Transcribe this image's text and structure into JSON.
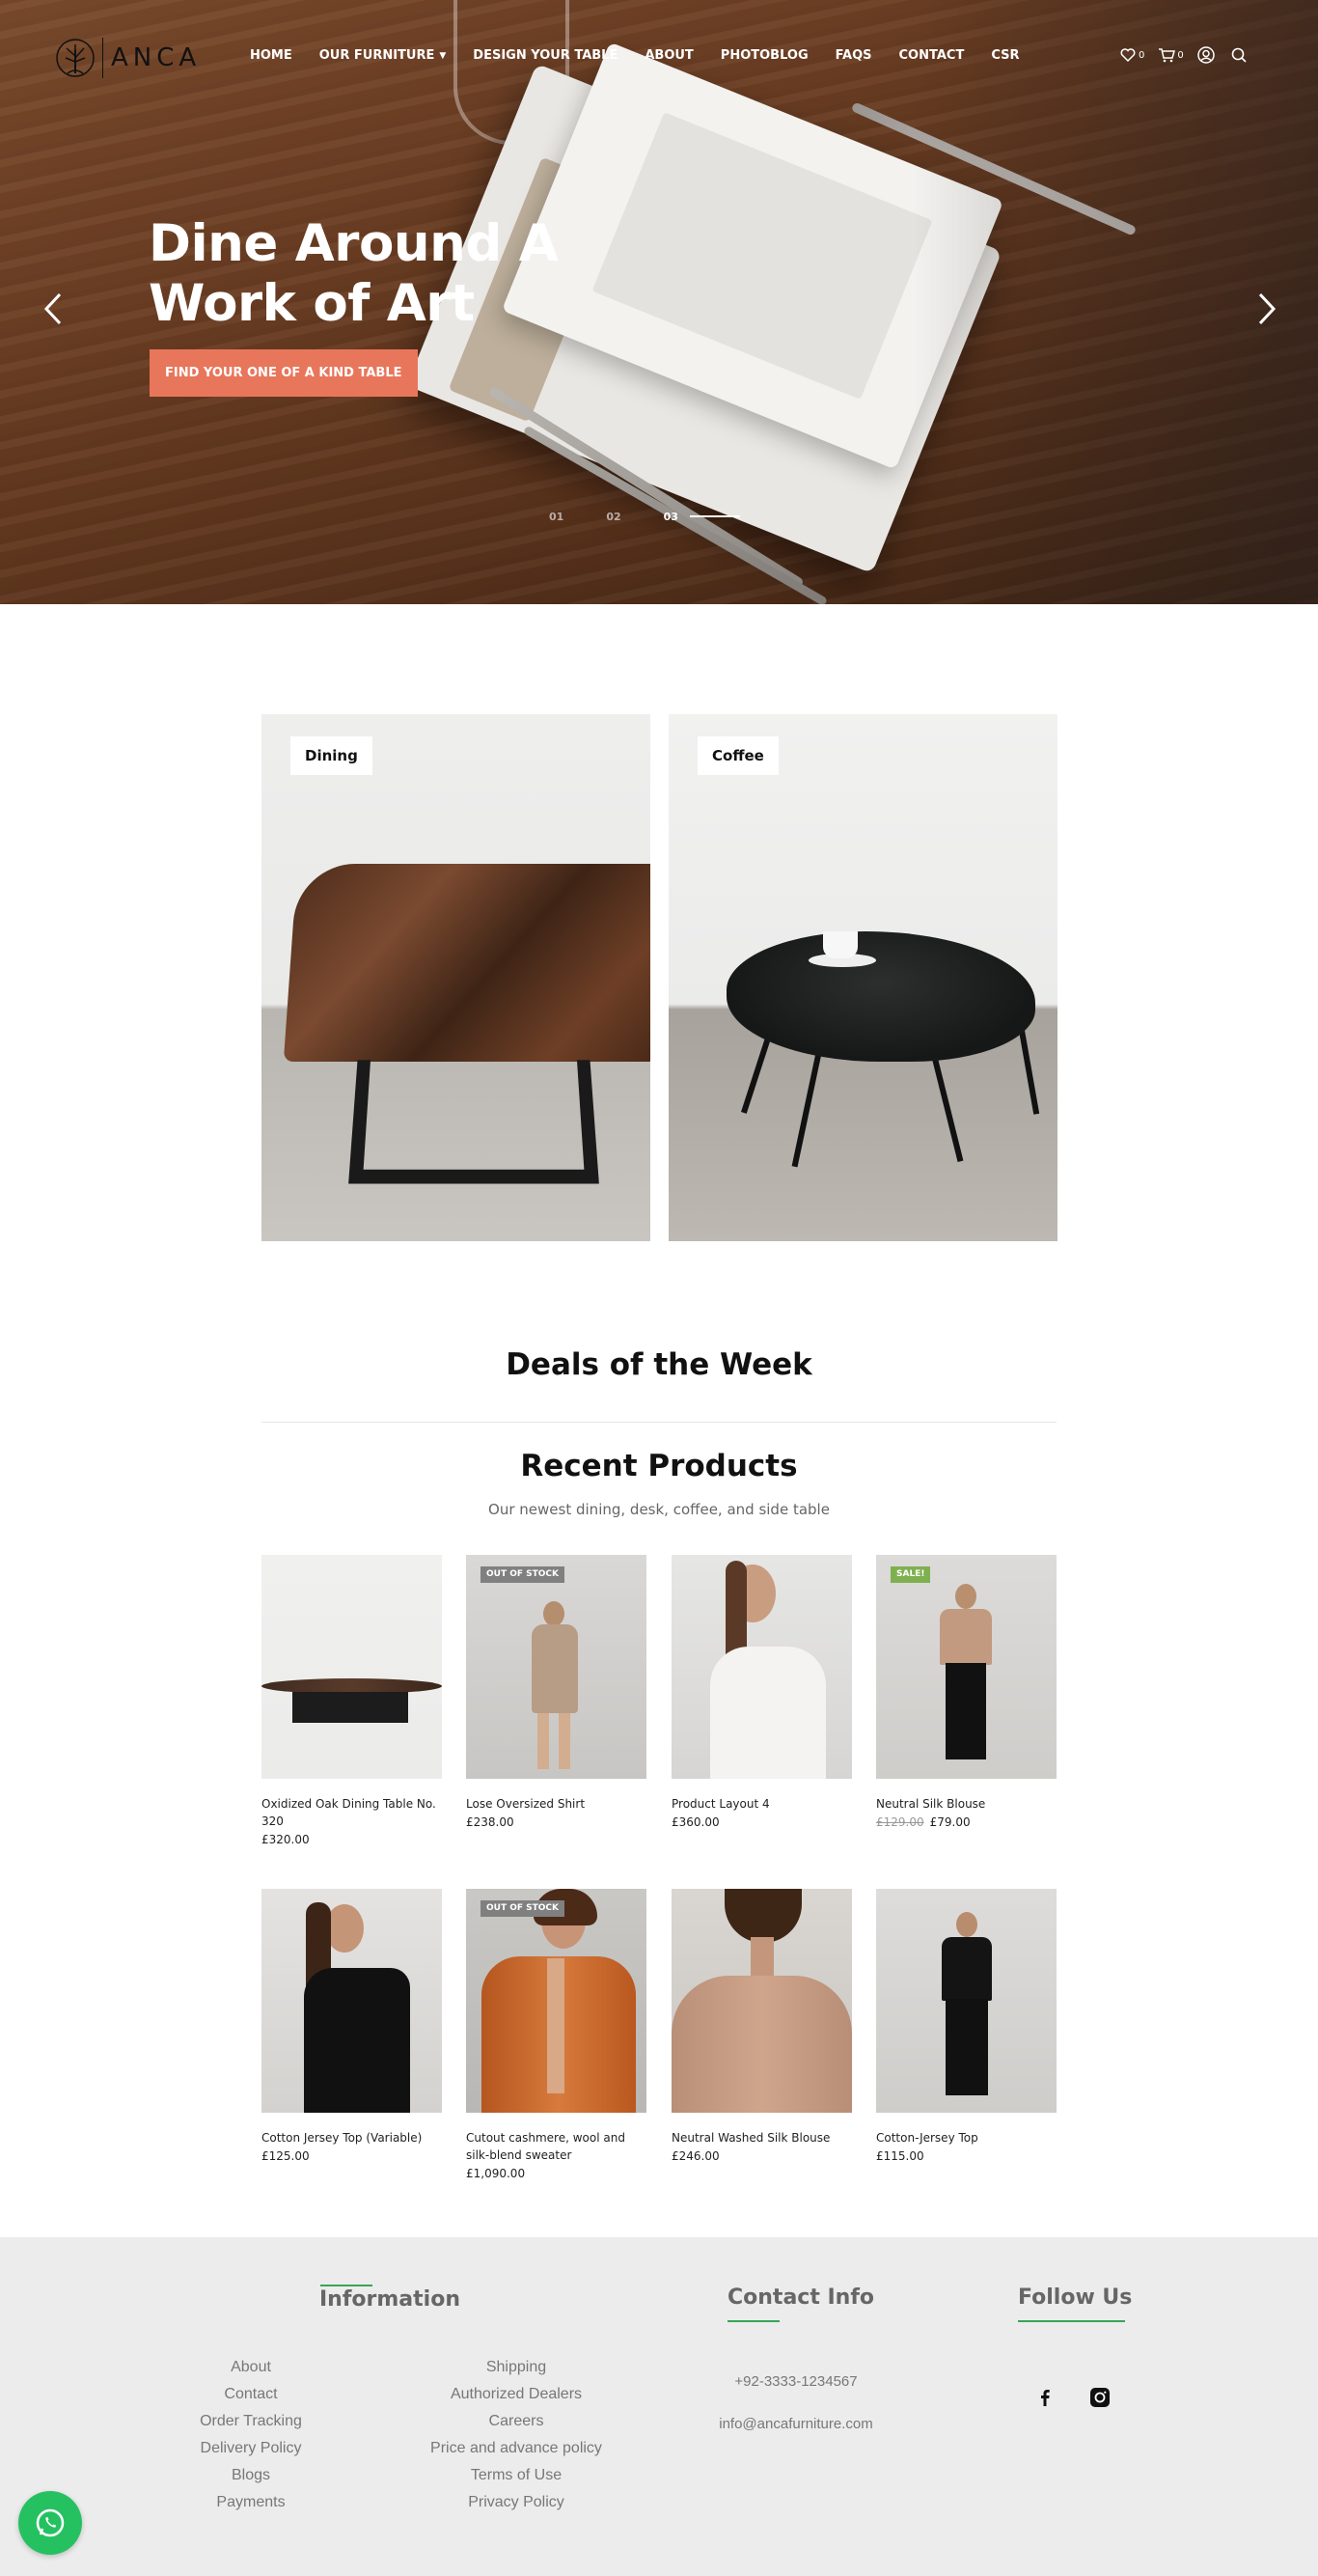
{
  "brand": {
    "name": "ANCA"
  },
  "nav": {
    "items": [
      "HOME",
      "OUR FURNITURE",
      "DESIGN YOUR TABLE",
      "ABOUT",
      "PHOTOBLOG",
      "FAQS",
      "CONTACT",
      "CSR"
    ]
  },
  "header_icons": {
    "wishlist_icon": "heart-icon",
    "wishlist_count": "0",
    "cart_icon": "cart-icon",
    "cart_count": "0",
    "account_icon": "user-icon",
    "search_icon": "search-icon"
  },
  "hero": {
    "title": "Dine Around A\nWork of Art",
    "cta_label": "FIND YOUR ONE OF A KIND TABLE",
    "slides": [
      "01",
      "02",
      "03"
    ],
    "active_slide": "03",
    "cta_color": "#e8765b"
  },
  "categories": [
    {
      "label": "Dining"
    },
    {
      "label": "Coffee"
    }
  ],
  "deals": {
    "title": "Deals of the Week"
  },
  "recent": {
    "title": "Recent Products",
    "subtitle": "Our newest dining, desk, coffee, and side table",
    "products": [
      {
        "name": "Oxidized Oak Dining Table No. 320",
        "price": "£320.00",
        "badge": ""
      },
      {
        "name": "Lose Oversized Shirt",
        "price": "£238.00",
        "badge": "OUT OF STOCK"
      },
      {
        "name": "Product Layout 4",
        "price": "£360.00",
        "badge": ""
      },
      {
        "name": "Neutral Silk Blouse",
        "old_price": "£129.00",
        "price": "£79.00",
        "badge": "SALE!"
      },
      {
        "name": "Cotton Jersey Top (Variable)",
        "price": "£125.00",
        "badge": ""
      },
      {
        "name": "Cutout cashmere, wool and silk-blend sweater",
        "price": "£1,090.00",
        "badge": "OUT OF STOCK"
      },
      {
        "name": "Neutral Washed Silk Blouse",
        "price": "£246.00",
        "badge": ""
      },
      {
        "name": "Cotton-Jersey Top",
        "price": "£115.00",
        "badge": ""
      }
    ]
  },
  "footer": {
    "information_title": "Information",
    "info_col1": [
      "About",
      "Contact",
      "Order Tracking",
      "Delivery Policy",
      "Blogs",
      "Payments"
    ],
    "info_col2": [
      "Shipping",
      "Authorized Dealers",
      "Careers",
      "Price and advance policy",
      "Terms of Use",
      "Privacy Policy"
    ],
    "contact_title": "Contact Info",
    "phone": "+92-3333-1234567",
    "email": "info@ancafurniture.com",
    "follow_title": "Follow Us",
    "social_icons": [
      "facebook-icon",
      "instagram-icon"
    ],
    "accent": "#3aa457"
  },
  "whatsapp_icon": "whatsapp-icon"
}
